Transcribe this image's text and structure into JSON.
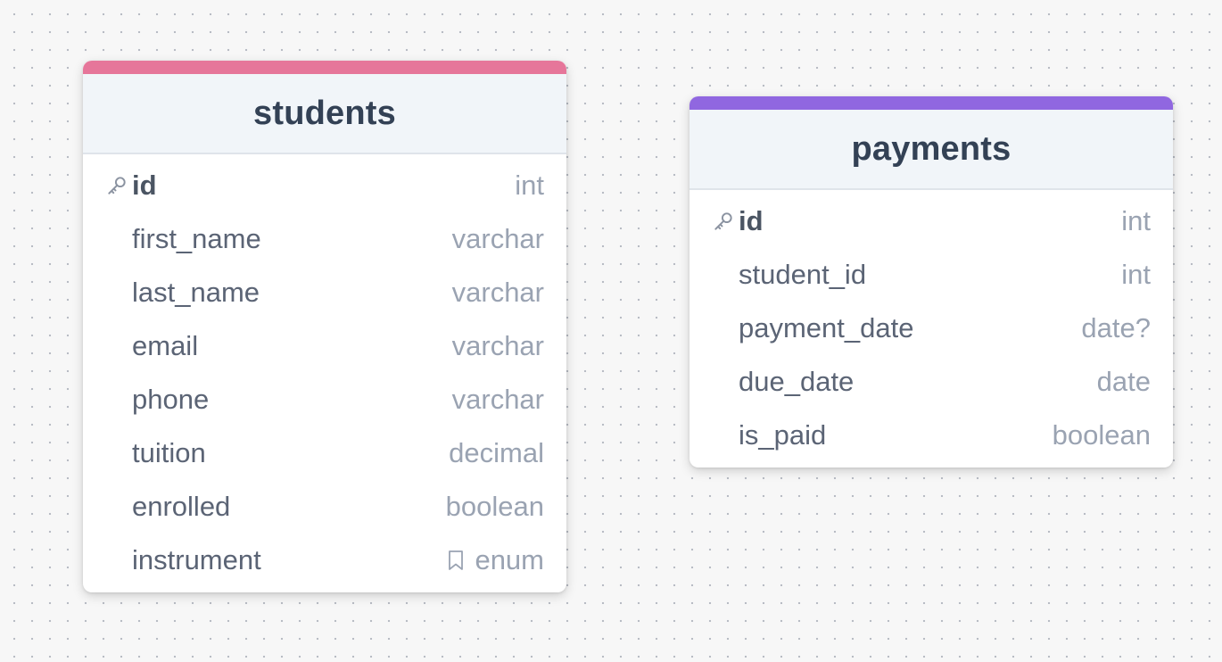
{
  "tables": [
    {
      "name": "students",
      "accent_color": "#e6769a",
      "columns": [
        {
          "name": "id",
          "type": "int",
          "primary_key": true,
          "icon": "key-icon"
        },
        {
          "name": "first_name",
          "type": "varchar"
        },
        {
          "name": "last_name",
          "type": "varchar"
        },
        {
          "name": "email",
          "type": "varchar"
        },
        {
          "name": "phone",
          "type": "varchar"
        },
        {
          "name": "tuition",
          "type": "decimal"
        },
        {
          "name": "enrolled",
          "type": "boolean"
        },
        {
          "name": "instrument",
          "type": "enum",
          "type_icon": "bookmark-icon"
        }
      ]
    },
    {
      "name": "payments",
      "accent_color": "#9067e0",
      "columns": [
        {
          "name": "id",
          "type": "int",
          "primary_key": true,
          "icon": "key-icon"
        },
        {
          "name": "student_id",
          "type": "int"
        },
        {
          "name": "payment_date",
          "type": "date?"
        },
        {
          "name": "due_date",
          "type": "date"
        },
        {
          "name": "is_paid",
          "type": "boolean"
        }
      ]
    }
  ]
}
